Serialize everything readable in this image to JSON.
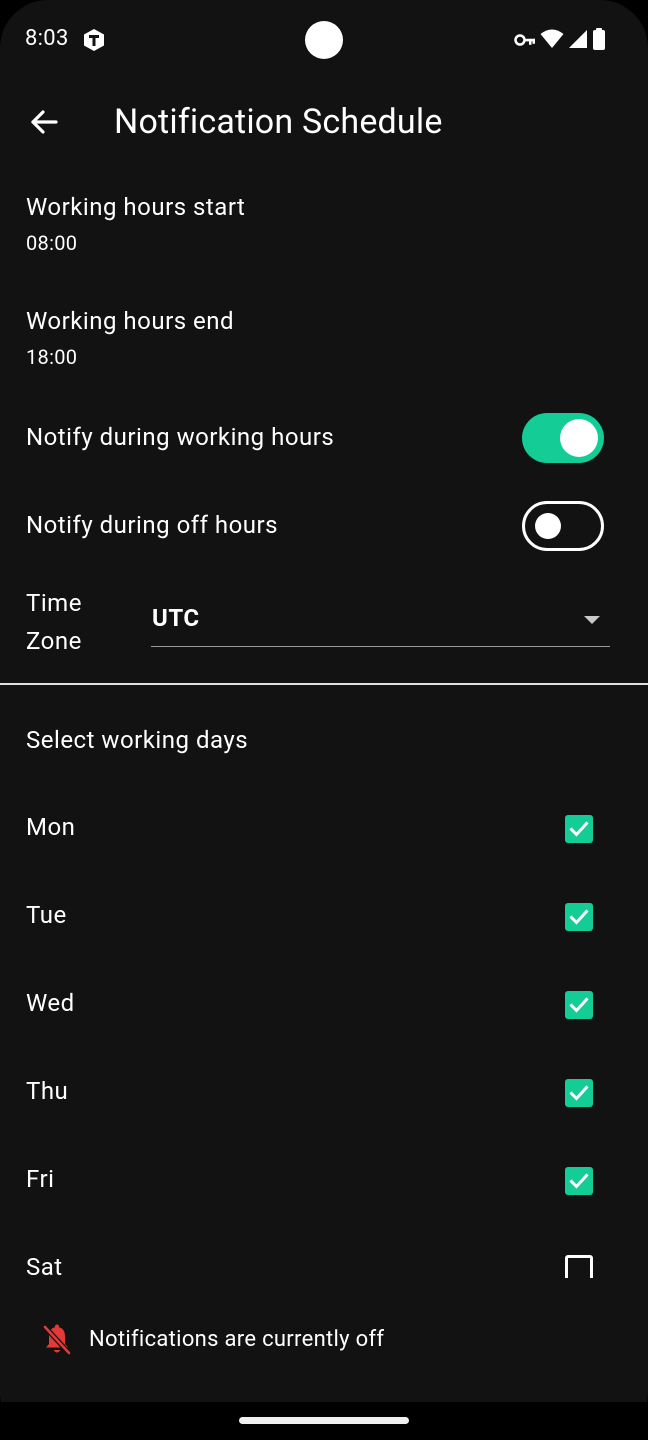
{
  "status_bar": {
    "time": "8:03",
    "icons": [
      "app-badge-icon",
      "vpn-key-icon",
      "wifi-icon",
      "cell-signal-icon",
      "battery-icon"
    ]
  },
  "app_bar": {
    "title": "Notification Schedule",
    "back_icon": "arrow-back-icon"
  },
  "settings": {
    "start": {
      "title": "Working hours start",
      "value": "08:00"
    },
    "end": {
      "title": "Working hours end",
      "value": "18:00"
    },
    "notify_working": {
      "title": "Notify during working hours",
      "on": true
    },
    "notify_off": {
      "title": "Notify during off hours",
      "on": false
    },
    "timezone": {
      "label": "Time Zone",
      "value": "UTC"
    }
  },
  "days": {
    "title": "Select working days",
    "items": [
      {
        "label": "Mon",
        "checked": true
      },
      {
        "label": "Tue",
        "checked": true
      },
      {
        "label": "Wed",
        "checked": true
      },
      {
        "label": "Thu",
        "checked": true
      },
      {
        "label": "Fri",
        "checked": true
      },
      {
        "label": "Sat",
        "checked": false
      }
    ]
  },
  "footer": {
    "message": "Notifications are currently off",
    "icon": "bell-off-icon",
    "icon_color": "#e53935"
  },
  "colors": {
    "accent": "#14cc96",
    "background": "#121212"
  }
}
